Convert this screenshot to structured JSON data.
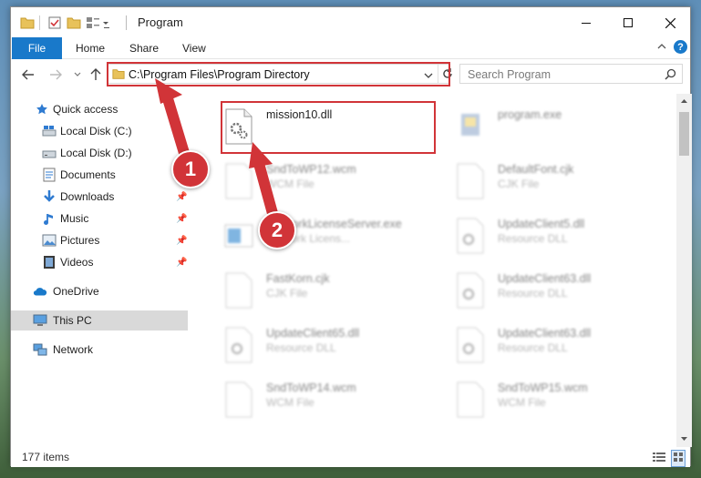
{
  "window": {
    "title": "Program",
    "minimize_icon": "minimize-icon",
    "maximize_icon": "maximize-icon",
    "close_icon": "close-icon"
  },
  "ribbon": {
    "tabs": [
      "File",
      "Home",
      "Share",
      "View"
    ]
  },
  "address_bar": {
    "path": "C:\\Program Files\\Program Directory"
  },
  "search": {
    "placeholder": "Search Program"
  },
  "nav_pane": {
    "items": [
      {
        "label": "Quick access",
        "icon": "star-icon"
      },
      {
        "label": "Local Disk (C:)",
        "icon": "drive-icon"
      },
      {
        "label": "Local Disk (D:)",
        "icon": "drive-icon"
      },
      {
        "label": "Documents",
        "icon": "documents-icon"
      },
      {
        "label": "Downloads",
        "icon": "download-icon"
      },
      {
        "label": "Music",
        "icon": "music-icon"
      },
      {
        "label": "Pictures",
        "icon": "pictures-icon"
      },
      {
        "label": "Videos",
        "icon": "videos-icon"
      },
      {
        "label": "OneDrive",
        "icon": "cloud-icon"
      },
      {
        "label": "This PC",
        "icon": "computer-icon"
      },
      {
        "label": "Network",
        "icon": "network-icon"
      }
    ]
  },
  "files": [
    {
      "name": "mission10.dll",
      "type": ""
    },
    {
      "name": "program.exe",
      "type": ""
    },
    {
      "name": "SndToWP12.wcm",
      "type": "WCM File"
    },
    {
      "name": "DefaultFont.cjk",
      "type": "CJK File"
    },
    {
      "name": "NetworkLicenseServer.exe",
      "type": "Network Licens..."
    },
    {
      "name": "UpdateClient5.dll",
      "type": "Resource DLL"
    },
    {
      "name": "FastKorn.cjk",
      "type": "CJK File"
    },
    {
      "name": "UpdateClient63.dll",
      "type": "Resource DLL"
    },
    {
      "name": "UpdateClient65.dll",
      "type": "Resource DLL"
    },
    {
      "name": "UpdateClient63.dll",
      "type": "Resource DLL"
    },
    {
      "name": "SndToWP14.wcm",
      "type": "WCM File"
    },
    {
      "name": "SndToWP15.wcm",
      "type": "WCM File"
    }
  ],
  "status": {
    "item_count": "177 items"
  },
  "callouts": [
    "1",
    "2"
  ],
  "colors": {
    "accent": "#1979ca",
    "highlight": "#d13438"
  }
}
